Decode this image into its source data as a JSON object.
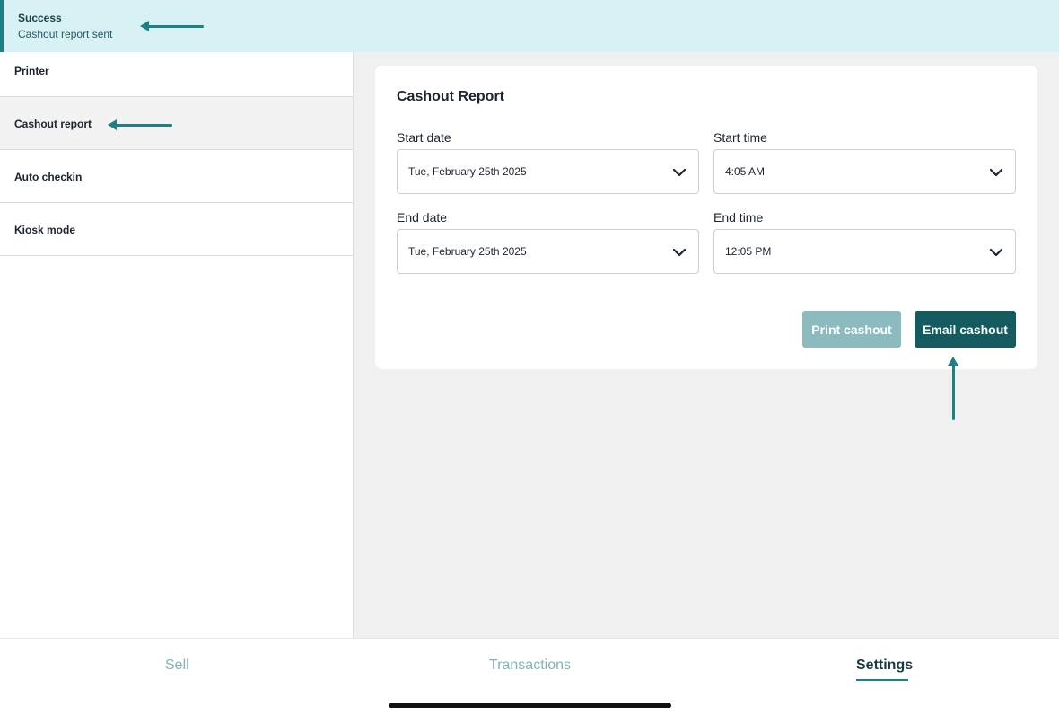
{
  "toast": {
    "title": "Success",
    "message": "Cashout report sent"
  },
  "sidebar": {
    "items": [
      {
        "label": "Printer"
      },
      {
        "label": "Cashout report"
      },
      {
        "label": "Auto checkin"
      },
      {
        "label": "Kiosk mode"
      }
    ],
    "active_item": "Cashout report"
  },
  "cashout": {
    "title": "Cashout Report",
    "start_date_label": "Start date",
    "start_date_value": "Tue, February 25th 2025",
    "start_time_label": "Start time",
    "start_time_value": "4:05 AM",
    "end_date_label": "End date",
    "end_date_value": "Tue, February 25th 2025",
    "end_time_label": "End time",
    "end_time_value": "12:05 PM",
    "print_label": "Print cashout",
    "email_label": "Email cashout"
  },
  "tabs": [
    {
      "label": "Sell",
      "active": false
    },
    {
      "label": "Transactions",
      "active": false
    },
    {
      "label": "Settings",
      "active": true
    }
  ],
  "colors": {
    "accent": "#1f7f87",
    "toast_bg": "#d7f1f4",
    "primary_button": "#135b5e",
    "disabled_button": "#8bbabf",
    "main_bg": "#f0f0f0"
  },
  "icons": {
    "dropdown": "chevron-down-icon",
    "annotation": "arrow-icon"
  }
}
